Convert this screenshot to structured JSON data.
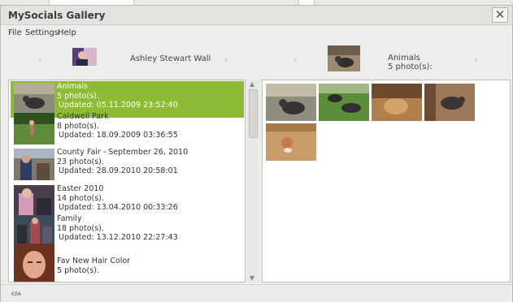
{
  "window": {
    "title": "MySocials Gallery"
  },
  "menu": {
    "items": [
      "File",
      "Settings",
      "Help"
    ]
  },
  "left_header": {
    "label": "Ashley Stewart Wall",
    "prev_icon": "chevron-left-icon",
    "next_icon": "chevron-right-icon"
  },
  "right_header": {
    "name": "Animals",
    "count": "5 photo(s):",
    "prev_icon": "chevron-left-icon",
    "next_icon": "chevron-right-icon"
  },
  "albums": [
    {
      "name": "Animals",
      "count": "5 photo(s).",
      "updated": "Updated: 05.11.2009 23:52:40",
      "selected": true
    },
    {
      "name": "Caldwell Park",
      "count": "8 photo(s).",
      "updated": "Updated: 18.09.2009 03:36:55",
      "selected": false
    },
    {
      "name": "County Fair - September 26, 2010",
      "count": "23 photo(s).",
      "updated": "Updated: 28.09.2010 20:58:01",
      "selected": false
    },
    {
      "name": "Easter 2010",
      "count": "14 photo(s).",
      "updated": "Updated: 13.04.2010 00:33:26",
      "selected": false
    },
    {
      "name": "Family",
      "count": "18 photo(s).",
      "updated": "Updated: 13.12.2010 22:27:43",
      "selected": false
    },
    {
      "name": "Fav New Hair Color",
      "count": "5 photo(s).",
      "updated": "",
      "selected": false
    }
  ],
  "status": {
    "text": "€BA"
  },
  "colors": {
    "selection": "#8dbb34"
  }
}
